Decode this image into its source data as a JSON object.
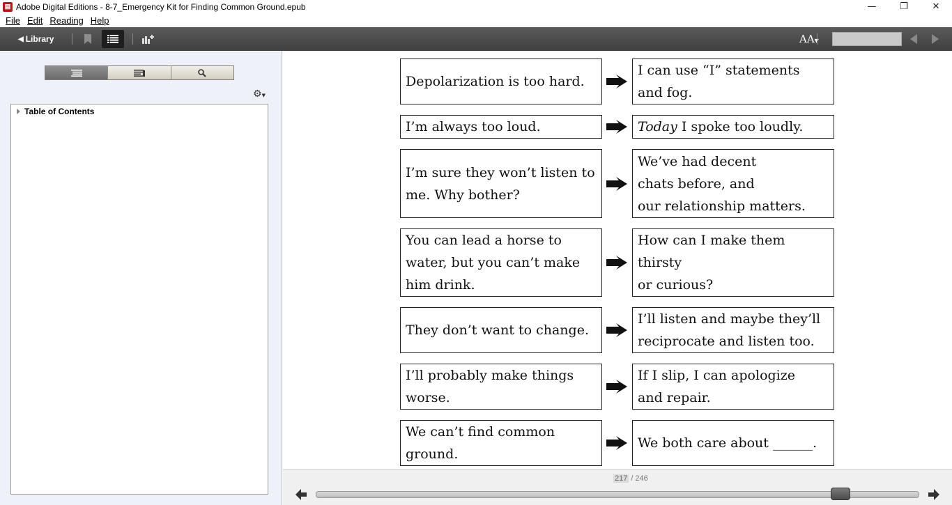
{
  "window": {
    "title": "Adobe Digital Editions - 8-7_Emergency Kit for Finding Common Ground.epub",
    "minimize": "—",
    "restore": "❐",
    "close": "✕"
  },
  "menu": [
    "File",
    "Edit",
    "Reading",
    "Help"
  ],
  "toolbar": {
    "library_label": "Library",
    "font_size_label": "AA"
  },
  "sidebar": {
    "toc_label": "Table of Contents"
  },
  "reader": {
    "rows": [
      {
        "left": [
          "Depolarization is too hard."
        ],
        "right": [
          "I can use “I” statements",
          "and fog."
        ]
      },
      {
        "left": [
          "I’m always too loud."
        ],
        "right_italic": "Today",
        "right": [
          " I spoke too loudly."
        ]
      },
      {
        "left": [
          "I’m sure they won’t listen to",
          "me. Why bother?"
        ],
        "right": [
          "We’ve had decent",
          "chats before, and",
          "our relationship matters."
        ]
      },
      {
        "left": [
          "You can lead a horse to",
          "water, but you can’t make",
          "him drink."
        ],
        "right": [
          "How can I make them thirsty",
          "or curious?"
        ]
      },
      {
        "left": [
          "They don’t want to change."
        ],
        "right": [
          "I’ll listen and maybe they’ll",
          "reciprocate and listen too."
        ]
      },
      {
        "left": [
          "I’ll probably make things",
          "worse."
        ],
        "right": [
          "If I slip, I can apologize",
          "and repair."
        ]
      },
      {
        "left": [
          "We can’t find common",
          "ground."
        ],
        "right": [
          "We both care about ______."
        ]
      }
    ]
  },
  "pagination": {
    "current": "217",
    "separator": "/",
    "total": "246",
    "progress_fraction": 0.882
  }
}
